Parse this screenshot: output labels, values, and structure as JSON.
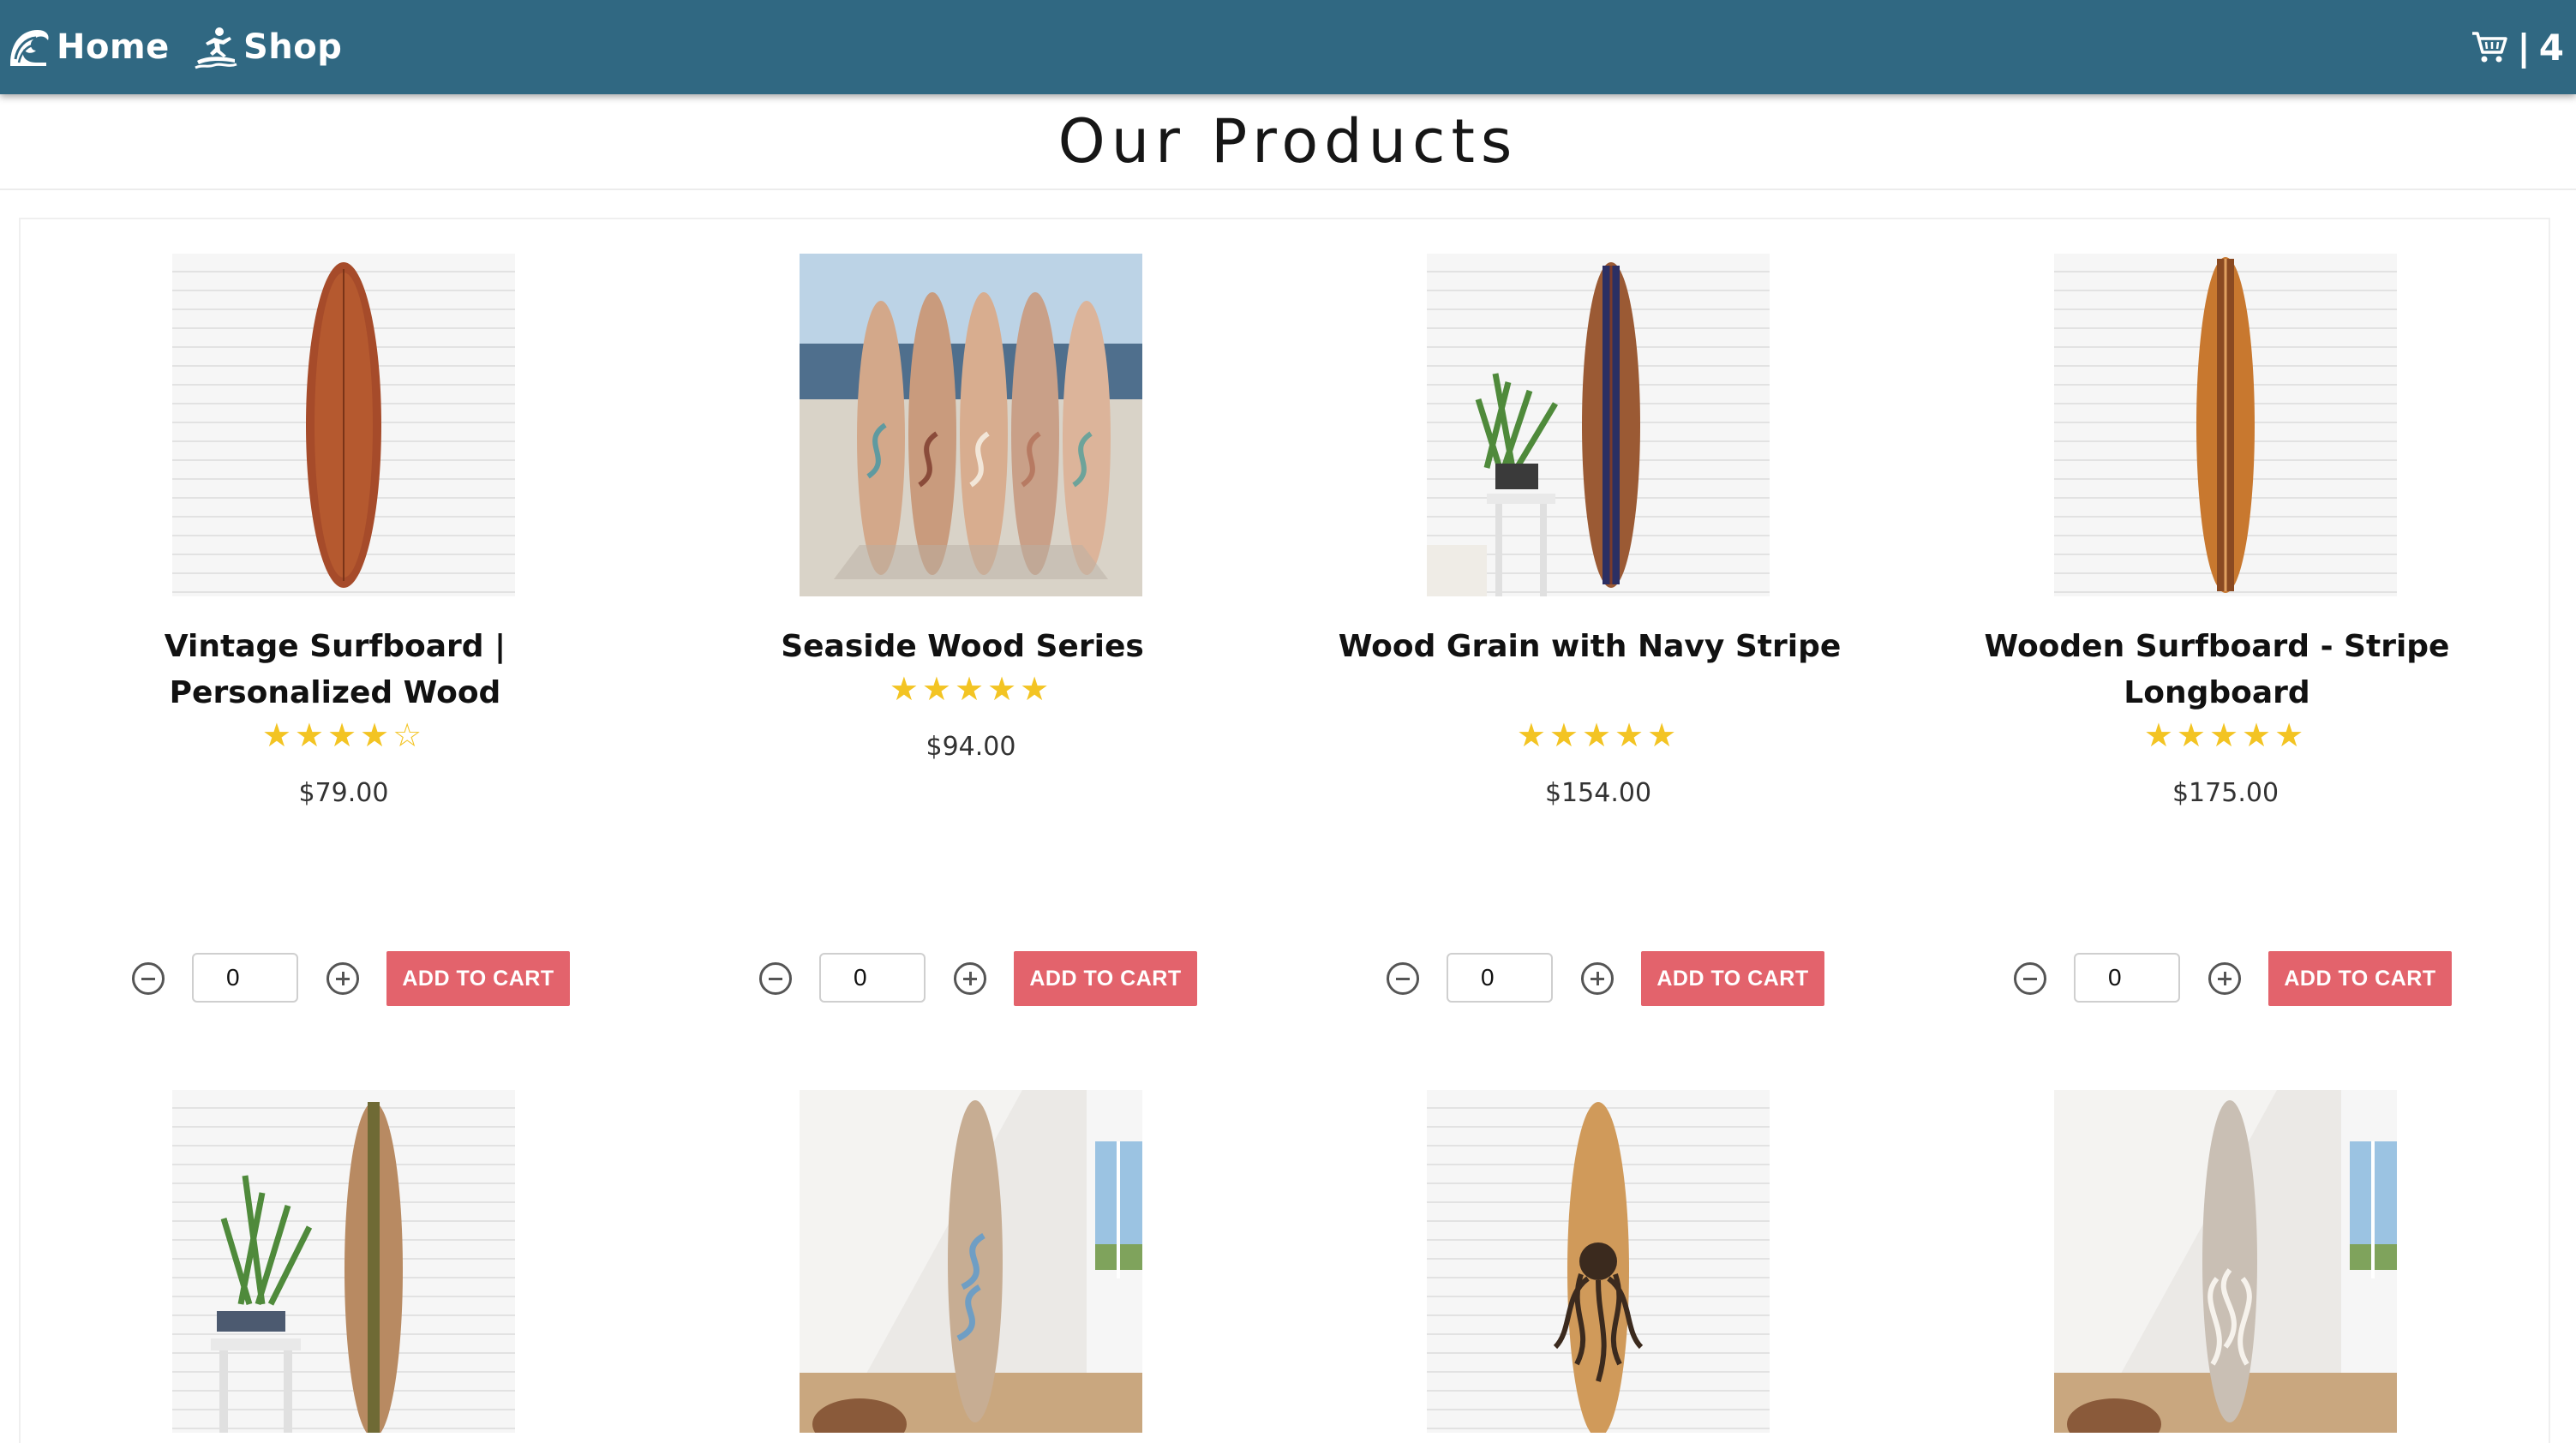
{
  "nav": {
    "home_label": "Home",
    "shop_label": "Shop",
    "cart_separator": "|",
    "cart_count": "4",
    "bar_color": "#306882"
  },
  "page": {
    "title": "Our Products"
  },
  "products": [
    {
      "name": "Vintage Surfboard | Personalized Wood",
      "rating": 4,
      "stars": "★★★★☆",
      "price": "$79.00",
      "qty": "0",
      "button": "ADD TO CART"
    },
    {
      "name": "Seaside Wood Series",
      "rating": 5,
      "stars": "★★★★★",
      "price": "$94.00",
      "qty": "0",
      "button": "ADD TO CART"
    },
    {
      "name": "Wood Grain with Navy Stripe",
      "rating": 5,
      "stars": "★★★★★",
      "price": "$154.00",
      "qty": "0",
      "button": "ADD TO CART"
    },
    {
      "name": "Wooden Surfboard - Stripe Longboard",
      "rating": 5,
      "stars": "★★★★★",
      "price": "$175.00",
      "qty": "0",
      "button": "ADD TO CART"
    }
  ],
  "colors": {
    "accent_button": "#e3636c",
    "star": "#f3c423"
  },
  "icons": [
    "wave-logo-icon",
    "surfer-icon",
    "cart-icon",
    "minus-circle-icon",
    "plus-circle-icon"
  ]
}
